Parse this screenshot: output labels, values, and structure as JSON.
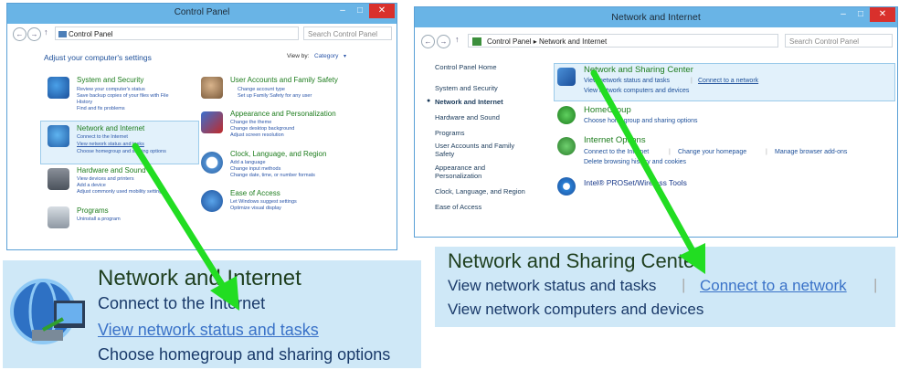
{
  "left_window": {
    "title": "Control Panel",
    "address_path": "Control Panel",
    "search_placeholder": "Search Control Panel",
    "heading": "Adjust your computer's settings",
    "view_by_label": "View by:",
    "view_by_value": "Category",
    "categories": [
      {
        "title": "System and Security",
        "links": [
          "Review your computer's status",
          "Save backup copies of your files with File",
          "History",
          "Find and fix problems"
        ]
      },
      {
        "title": "Network and Internet",
        "links": [
          "Connect to the Internet",
          "View network status and tasks",
          "Choose homegroup and sharing options"
        ]
      },
      {
        "title": "Hardware and Sound",
        "links": [
          "View devices and printers",
          "Add a device",
          "Adjust commonly used mobility settings"
        ]
      },
      {
        "title": "Programs",
        "links": [
          "Uninstall a program"
        ]
      },
      {
        "title": "User Accounts and Family Safety",
        "links": [
          "Change account type",
          "Set up Family Safety for any user"
        ]
      },
      {
        "title": "Appearance and Personalization",
        "links": [
          "Change the theme",
          "Change desktop background",
          "Adjust screen resolution"
        ]
      },
      {
        "title": "Clock, Language, and Region",
        "links": [
          "Add a language",
          "Change input methods",
          "Change date, time, or number formats"
        ]
      },
      {
        "title": "Ease of Access",
        "links": [
          "Let Windows suggest settings",
          "Optimize visual display"
        ]
      }
    ]
  },
  "right_window": {
    "title": "Network and Internet",
    "address_crumbs": [
      "Control Panel",
      "Network and Internet"
    ],
    "search_placeholder": "Search Control Panel",
    "sidebar": [
      "Control Panel Home",
      "System and Security",
      "Network and Internet",
      "Hardware and Sound",
      "Programs",
      "User Accounts and Family Safety",
      "Appearance and Personalization",
      "Clock, Language, and Region",
      "Ease of Access"
    ],
    "sections": [
      {
        "title": "Network and Sharing Center",
        "links": [
          "View network status and tasks",
          "Connect to a network",
          "View network computers and devices"
        ]
      },
      {
        "title": "HomeGroup",
        "links": [
          "Choose homegroup and sharing options"
        ]
      },
      {
        "title": "Internet Options",
        "links": [
          "Connect to the Internet",
          "Change your homepage",
          "Manage browser add-ons",
          "Delete browsing history and cookies"
        ]
      },
      {
        "title": "Intel® PROSet/Wireless Tools",
        "links": []
      }
    ]
  },
  "zoom_left": {
    "title": "Network and Internet",
    "links": [
      "Connect to the Internet",
      "View network status and tasks",
      "Choose homegroup and sharing options"
    ]
  },
  "zoom_right": {
    "title": "Network and Sharing Center",
    "links": [
      "View network status and tasks",
      "Connect to a network",
      "View network computers and devices"
    ]
  },
  "colors": {
    "arrow": "#22dd22",
    "titlebar": "#69b4e6",
    "highlight": "#cfe8f7",
    "close": "#d9302c"
  }
}
